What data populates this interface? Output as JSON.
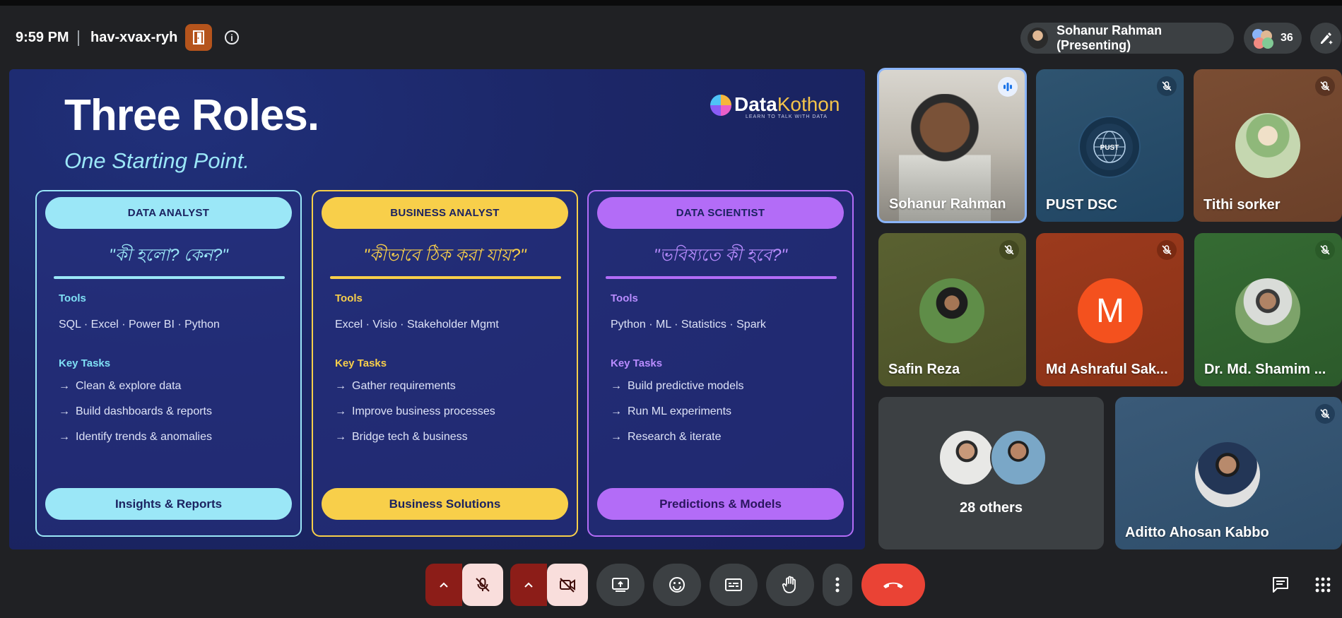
{
  "header": {
    "time": "9:59 PM",
    "meeting_code": "hav-xvax-ryh",
    "presenter_label": "Sohanur Rahman (Presenting)",
    "participant_count": "36"
  },
  "slide": {
    "title": "Three Roles.",
    "subtitle": "One Starting Point.",
    "brand": {
      "name_part1": "Data",
      "name_part2": "Kothon",
      "tagline": "LEARN TO TALK WITH DATA"
    },
    "cards": [
      {
        "role": "DATA ANALYST",
        "quote": "\"কী হলো? কেন?\"",
        "tools_label": "Tools",
        "tools": "SQL · Excel · Power BI · Python",
        "tasks_label": "Key Tasks",
        "tasks": [
          "Clean & explore data",
          "Build dashboards & reports",
          "Identify trends & anomalies"
        ],
        "outcome": "Insights & Reports",
        "accent": "#9be7f7",
        "label_color": "#7fe0f5"
      },
      {
        "role": "BUSINESS ANALYST",
        "quote": "\"কীভাবে ঠিক করা যায়?\"",
        "tools_label": "Tools",
        "tools": "Excel · Visio · Stakeholder Mgmt",
        "tasks_label": "Key Tasks",
        "tasks": [
          "Gather requirements",
          "Improve business processes",
          "Bridge tech & business"
        ],
        "outcome": "Business Solutions",
        "accent": "#f8cf4a",
        "label_color": "#f8cf4a"
      },
      {
        "role": "DATA SCIENTIST",
        "quote": "\"ভবিষ্যতে কী হবে?\"",
        "tools_label": "Tools",
        "tools": "Python · ML · Statistics · Spark",
        "tasks_label": "Key Tasks",
        "tasks": [
          "Build predictive models",
          "Run ML experiments",
          "Research & iterate"
        ],
        "outcome": "Predictions & Models",
        "accent": "#b36cf7",
        "label_color": "#b98cff"
      }
    ]
  },
  "participants": [
    {
      "name": "Sohanur Rahman",
      "status": "speaking"
    },
    {
      "name": "PUST DSC",
      "status": "muted"
    },
    {
      "name": "Tithi sorker",
      "status": "muted"
    },
    {
      "name": "Safin Reza",
      "status": "muted"
    },
    {
      "name": "Md Ashraful Sak...",
      "status": "muted",
      "initial": "M"
    },
    {
      "name": "Dr. Md. Shamim ...",
      "status": "muted"
    },
    {
      "name": "28 others"
    },
    {
      "name": "Aditto Ahosan Kabbo",
      "status": "muted"
    }
  ],
  "pust_logo_text": "PUST",
  "icons": [
    "door-icon",
    "info-icon",
    "mic-off-icon",
    "video-off-icon",
    "present-screen-icon",
    "emoji-icon",
    "captions-icon",
    "raise-hand-icon",
    "more-vert-icon",
    "call-end-icon",
    "chat-icon",
    "apps-grid-icon",
    "edit-icon"
  ],
  "colors": {
    "end_call": "#ea4335",
    "muted_pair": "#8c1d18",
    "muted_pair_light": "#f9dedc",
    "door_button": "#b5541c"
  }
}
